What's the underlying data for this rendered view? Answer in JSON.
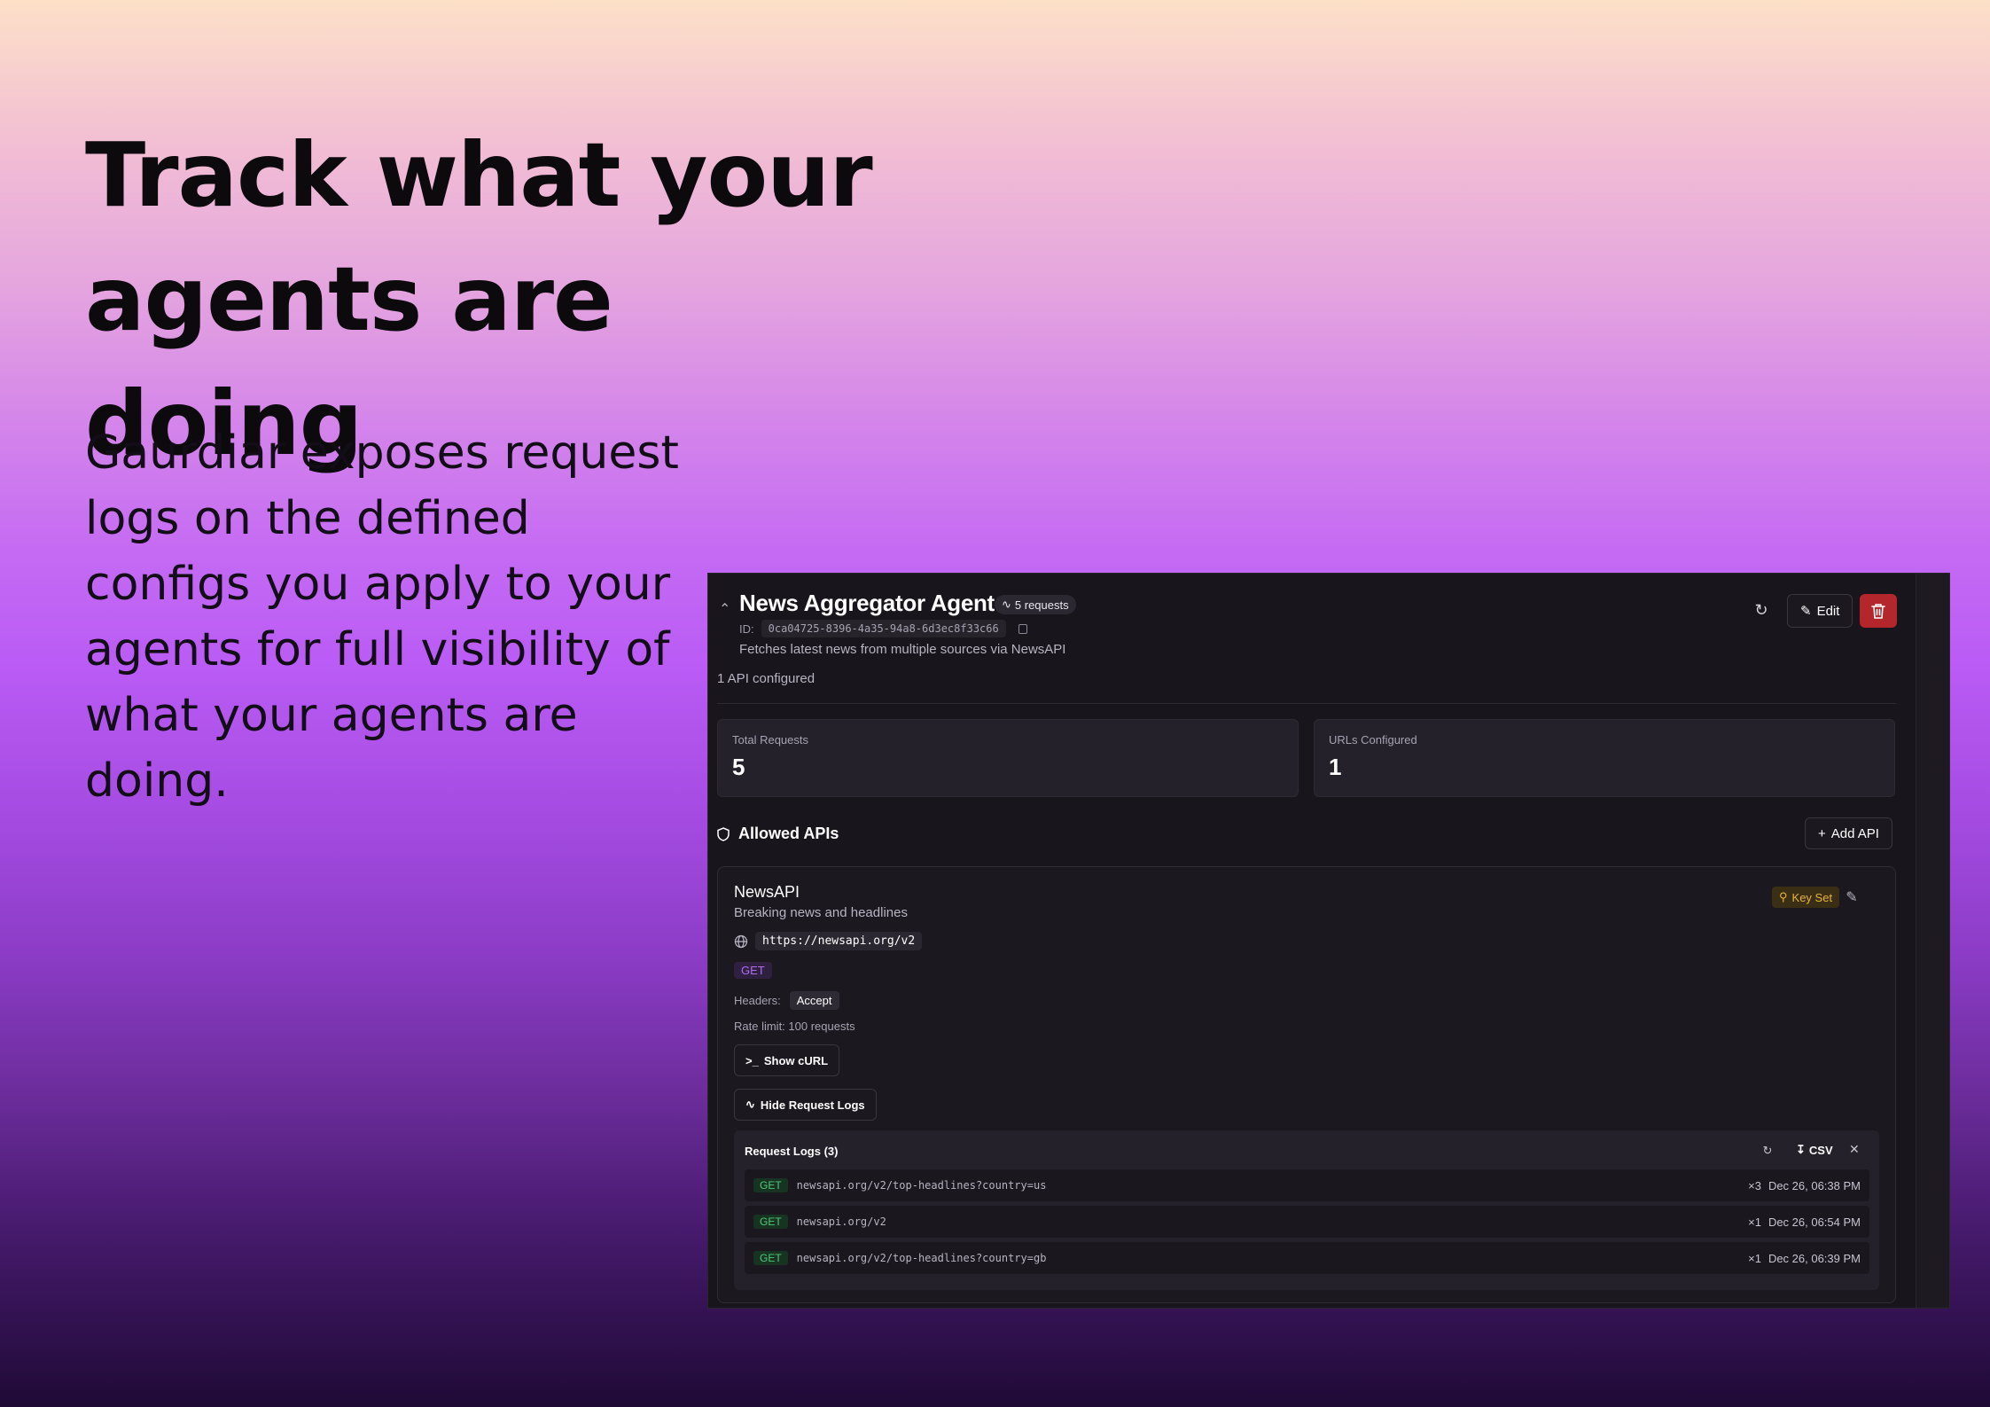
{
  "hero": {
    "headline": "Track what your agents are doing",
    "body": "Gaurdiar exposes request logs on the defined configs you apply to your agents for full visibility of what your agents are doing."
  },
  "agent": {
    "name": "News Aggregator Agent",
    "requests_badge": "5 requests",
    "id_label": "ID:",
    "id_value": "0ca04725-8396-4a35-94a8-6d3ec8f33c66",
    "description": "Fetches latest news from multiple sources via NewsAPI",
    "api_count": "1 API configured",
    "edit_label": "Edit"
  },
  "stats": [
    {
      "label": "Total Requests",
      "value": "5"
    },
    {
      "label": "URLs Configured",
      "value": "1"
    }
  ],
  "allowed_apis": {
    "title": "Allowed APIs",
    "add_label": "Add API"
  },
  "api_card": {
    "name": "NewsAPI",
    "description": "Breaking news and headlines",
    "url": "https://newsapi.org/v2",
    "method": "GET",
    "headers_label": "Headers:",
    "header_chip": "Accept",
    "rate_limit": "Rate limit: 100 requests",
    "key_status": "Key Set",
    "show_curl_label": "Show cURL",
    "hide_logs_label": "Hide Request Logs"
  },
  "logs": {
    "title": "Request Logs (3)",
    "csv_label": "CSV",
    "rows": [
      {
        "method": "GET",
        "url": "newsapi.org/v2/top-headlines?country=us",
        "count": "×3",
        "time": "Dec 26, 06:38 PM"
      },
      {
        "method": "GET",
        "url": "newsapi.org/v2",
        "count": "×1",
        "time": "Dec 26, 06:54 PM"
      },
      {
        "method": "GET",
        "url": "newsapi.org/v2/top-headlines?country=gb",
        "count": "×1",
        "time": "Dec 26, 06:39 PM"
      }
    ]
  },
  "colors": {
    "panel_bg": "#18151c",
    "delete_red": "#b3262b",
    "method_purple": "#b06df0",
    "log_green": "#4fc878",
    "key_amber": "#e6b43a"
  }
}
